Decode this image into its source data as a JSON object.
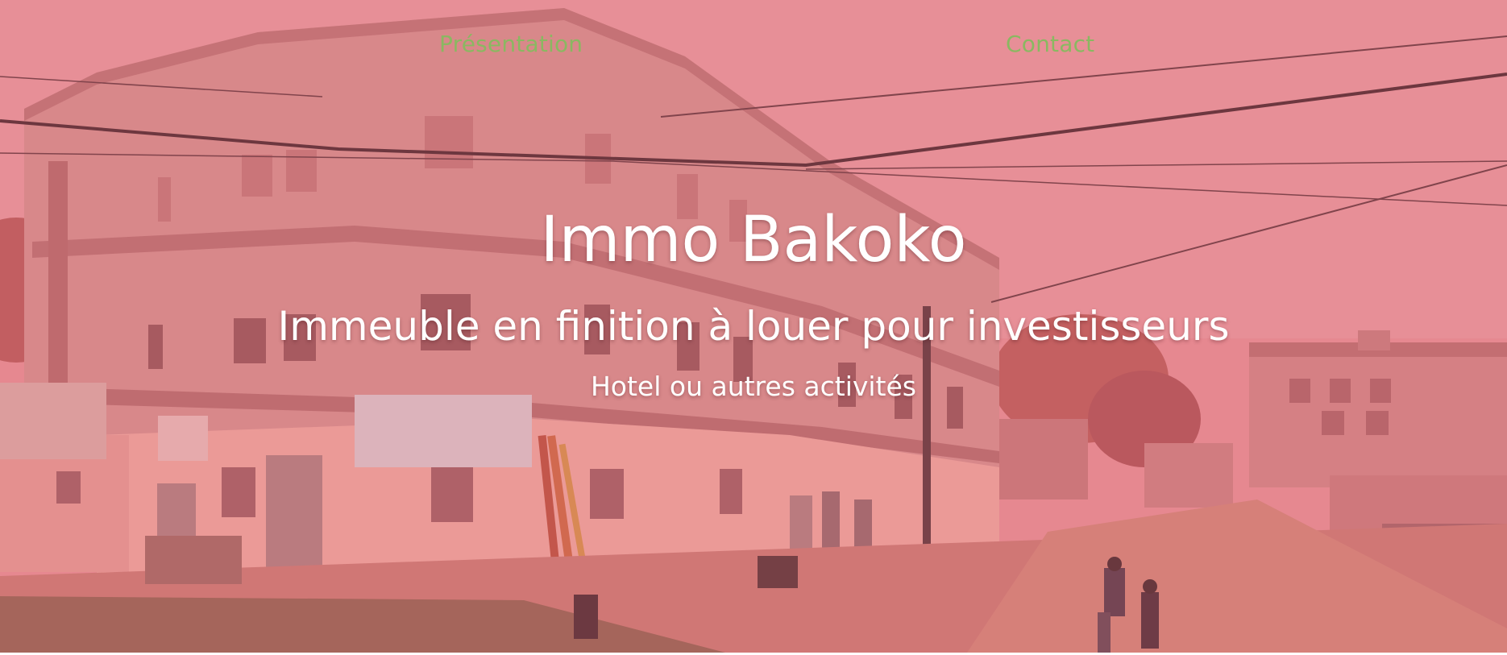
{
  "nav": {
    "items": [
      {
        "label": "Présentation"
      },
      {
        "label": "Contact"
      }
    ],
    "link_color": "#8ab861"
  },
  "hero": {
    "title": "Immo Bakoko",
    "subtitle": "Immeuble en finition à louer pour investisseurs",
    "tagline": "Hotel ou autres activités",
    "overlay_color": "#e65a69"
  }
}
